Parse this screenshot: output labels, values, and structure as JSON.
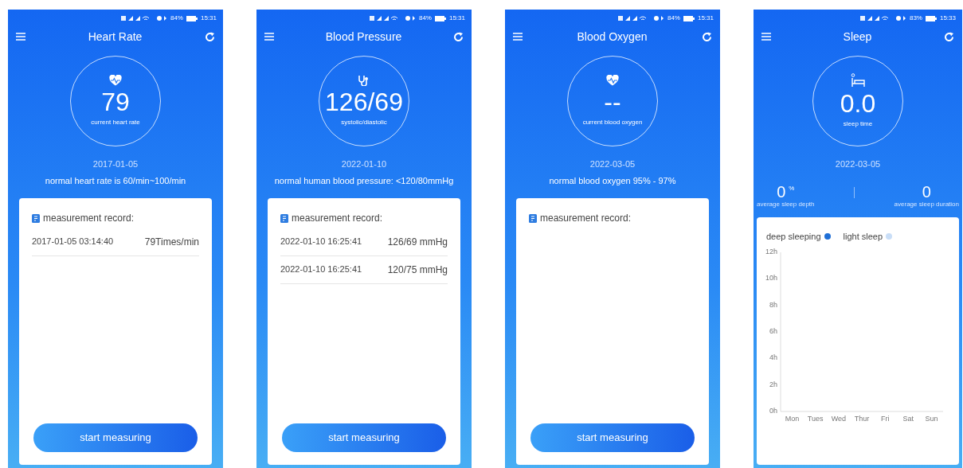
{
  "phones": [
    {
      "kind": "measure",
      "status": {
        "battery": "84%",
        "time": "15:31"
      },
      "title": "Heart Rate",
      "value": "79",
      "value_label": "current heart rate",
      "date": "2017-01-05",
      "note": "normal heart rate is 60/min~100/min",
      "record_title": "measurement record:",
      "records": [
        {
          "time": "2017-01-05 03:14:40",
          "value": "79Times/min"
        }
      ],
      "button": "start measuring"
    },
    {
      "kind": "measure",
      "status": {
        "battery": "84%",
        "time": "15:31"
      },
      "title": "Blood Pressure",
      "value": "126/69",
      "value_label": "systolic/diastolic",
      "date": "2022-01-10",
      "note": "normal human blood pressure: <120/80mmHg",
      "record_title": "measurement record:",
      "records": [
        {
          "time": "2022-01-10 16:25:41",
          "value": "126/69 mmHg"
        },
        {
          "time": "2022-01-10 16:25:41",
          "value": "120/75 mmHg"
        }
      ],
      "button": "start measuring"
    },
    {
      "kind": "measure",
      "status": {
        "battery": "84%",
        "time": "15:31"
      },
      "title": "Blood Oxygen",
      "value": "--",
      "value_label": "current blood oxygen",
      "date": "2022-03-05",
      "note": "normal blood oxygen 95% - 97%",
      "record_title": "measurement record:",
      "button": "start measuring"
    },
    {
      "kind": "sleep",
      "status": {
        "battery": "83%",
        "time": "15:33"
      },
      "title": "Sleep",
      "value": "0.0",
      "value_label": "sleep time",
      "date": "2022-03-05",
      "stats": [
        {
          "value": "0",
          "unit": "%",
          "label": "average sleep depth"
        },
        {
          "value": "0",
          "label": "average sleep duration"
        }
      ],
      "chart_data": {
        "type": "bar",
        "categories": [
          "Mon",
          "Tues",
          "Wed",
          "Thur",
          "Fri",
          "Sat",
          "Sun"
        ],
        "series": [
          {
            "name": "deep sleeping",
            "color": "#1f6fd6",
            "values": [
              0,
              0,
              0,
              0,
              0,
              0,
              0
            ]
          },
          {
            "name": "light sleep",
            "color": "#c9def7",
            "values": [
              0,
              0,
              0,
              0,
              0,
              0,
              0
            ]
          }
        ],
        "ylim": [
          0,
          12
        ],
        "yticks": [
          {
            "value": 0,
            "label": "0h"
          },
          {
            "value": 2,
            "label": "2h"
          },
          {
            "value": 4,
            "label": "4h"
          },
          {
            "value": 6,
            "label": "6h"
          },
          {
            "value": 8,
            "label": "8h"
          },
          {
            "value": 10,
            "label": "10h"
          },
          {
            "value": 12,
            "label": "12h"
          }
        ]
      }
    }
  ]
}
